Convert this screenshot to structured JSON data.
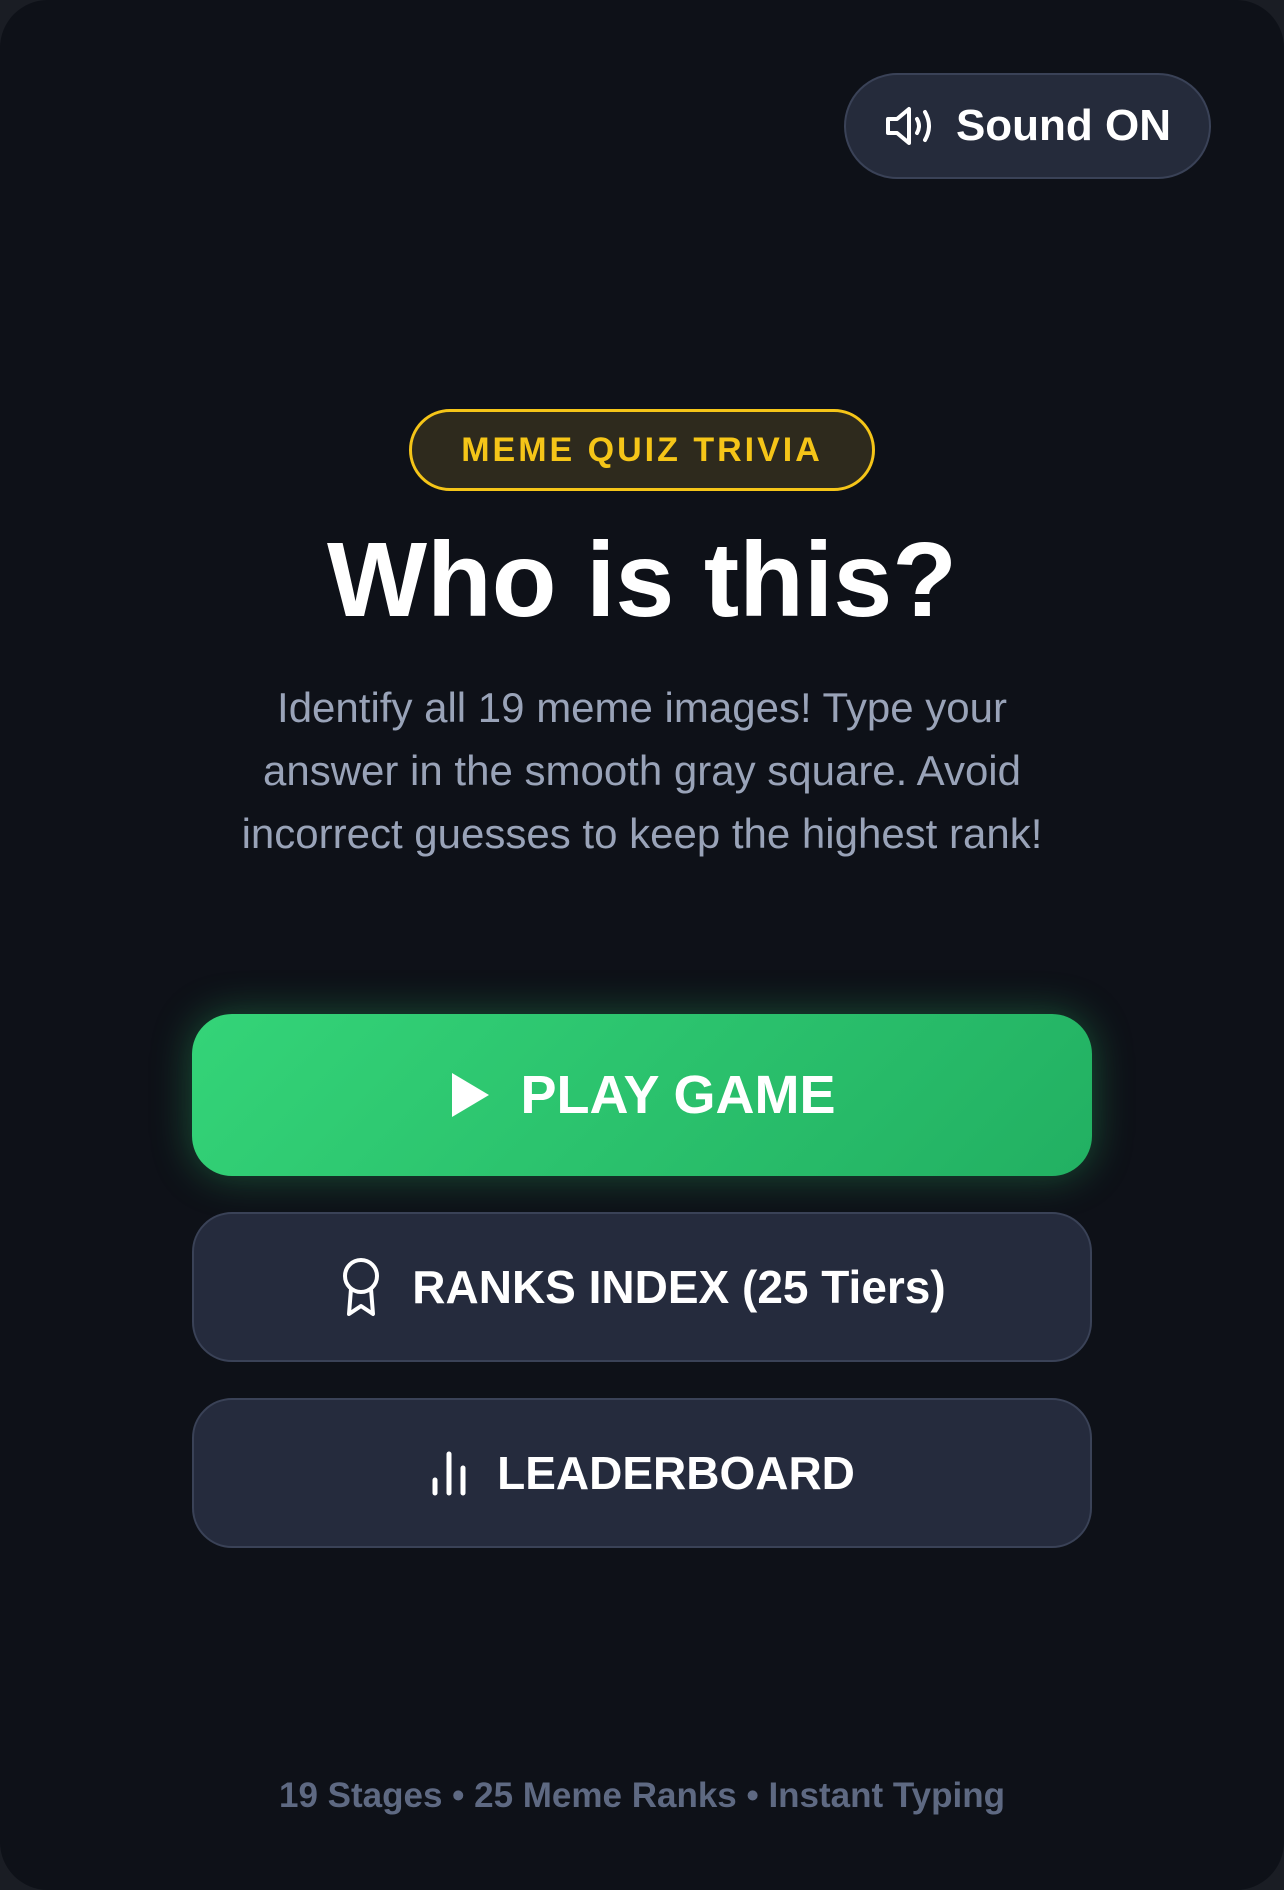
{
  "sound_toggle": {
    "label": "Sound ON",
    "icon": "speaker-icon"
  },
  "badge": {
    "label": "MEME QUIZ TRIVIA"
  },
  "hero": {
    "title": "Who is this?",
    "description": "Identify all 19 meme images! Type your answer in the smooth gray square. Avoid incorrect guesses to keep the highest rank!"
  },
  "buttons": {
    "play": {
      "label": "PLAY GAME",
      "icon": "play-icon"
    },
    "ranks": {
      "label": "RANKS INDEX (25 Tiers)",
      "icon": "award-ribbon-icon"
    },
    "leaderboard": {
      "label": "LEADERBOARD",
      "icon": "bar-chart-icon"
    }
  },
  "footer": {
    "text": "19 Stages • 25 Meme Ranks • Instant Typing"
  },
  "colors": {
    "background": "#0e1118",
    "accent_green": "#2ecc71",
    "badge_gold": "#f5c518",
    "secondary_button": "#252b3d",
    "muted_text": "#99a3b8",
    "footer_text": "#5e6982"
  }
}
